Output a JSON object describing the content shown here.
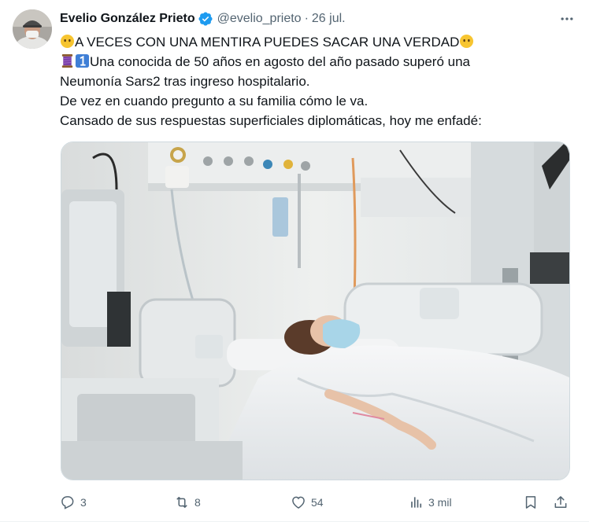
{
  "author": {
    "display_name": "Evelio González Prieto",
    "handle": "@evelio_prieto",
    "separator": "·",
    "date": "26 jul."
  },
  "tweet": {
    "line1": "A VECES CON UNA MENTIRA PUEDES SACAR UNA VERDAD",
    "line2": "Una conocida de 50 años en agosto del año pasado superó una",
    "line3": "Neumonía Sars2 tras ingreso hospitalario.",
    "line4": "De vez en cuando pregunto a su familia cómo le va.",
    "line5": "Cansado de sus respuestas superficiales diplomáticas, hoy me enfadé:"
  },
  "actions": {
    "replies": "3",
    "retweets": "8",
    "likes": "54",
    "views": "3 mil"
  },
  "icons": {
    "verified": "verified-badge-icon",
    "more": "more-icon",
    "reply": "reply-icon",
    "retweet": "retweet-icon",
    "like": "like-icon",
    "views": "views-icon",
    "bookmark": "bookmark-icon",
    "share": "share-icon"
  },
  "colors": {
    "verified": "#1d9bf0",
    "secondary_text": "#536471",
    "emoji_face": "#f7c531",
    "keycap": "#3f7fd6",
    "thread_spool": "#7a3fa8"
  }
}
